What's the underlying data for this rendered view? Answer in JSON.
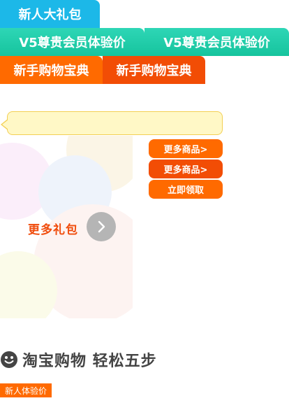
{
  "tabs": {
    "new_user_gift": "新人大礼包",
    "v5_trial": [
      "V5尊贵会员体验价",
      "V5尊贵会员体验价"
    ],
    "beginner_guide": [
      "新手购物宝典",
      "新手购物宝典"
    ]
  },
  "tooltip": {
    "text": ""
  },
  "buttons": {
    "more_products_1": "更多商品>",
    "more_products_2": "更多商品>",
    "claim_now": "立即领取"
  },
  "more_gifts": {
    "label": "更多礼包"
  },
  "section": {
    "title": "淘宝购物 轻松五步"
  },
  "badge": {
    "label": "新人体验价"
  },
  "colors": {
    "blue": "#1cb8e8",
    "green": "#16c49d",
    "orange": "#ff6a00",
    "orange_dark": "#f24d05",
    "text_orange": "#f04c0c",
    "gray": "#b5b5b5"
  }
}
